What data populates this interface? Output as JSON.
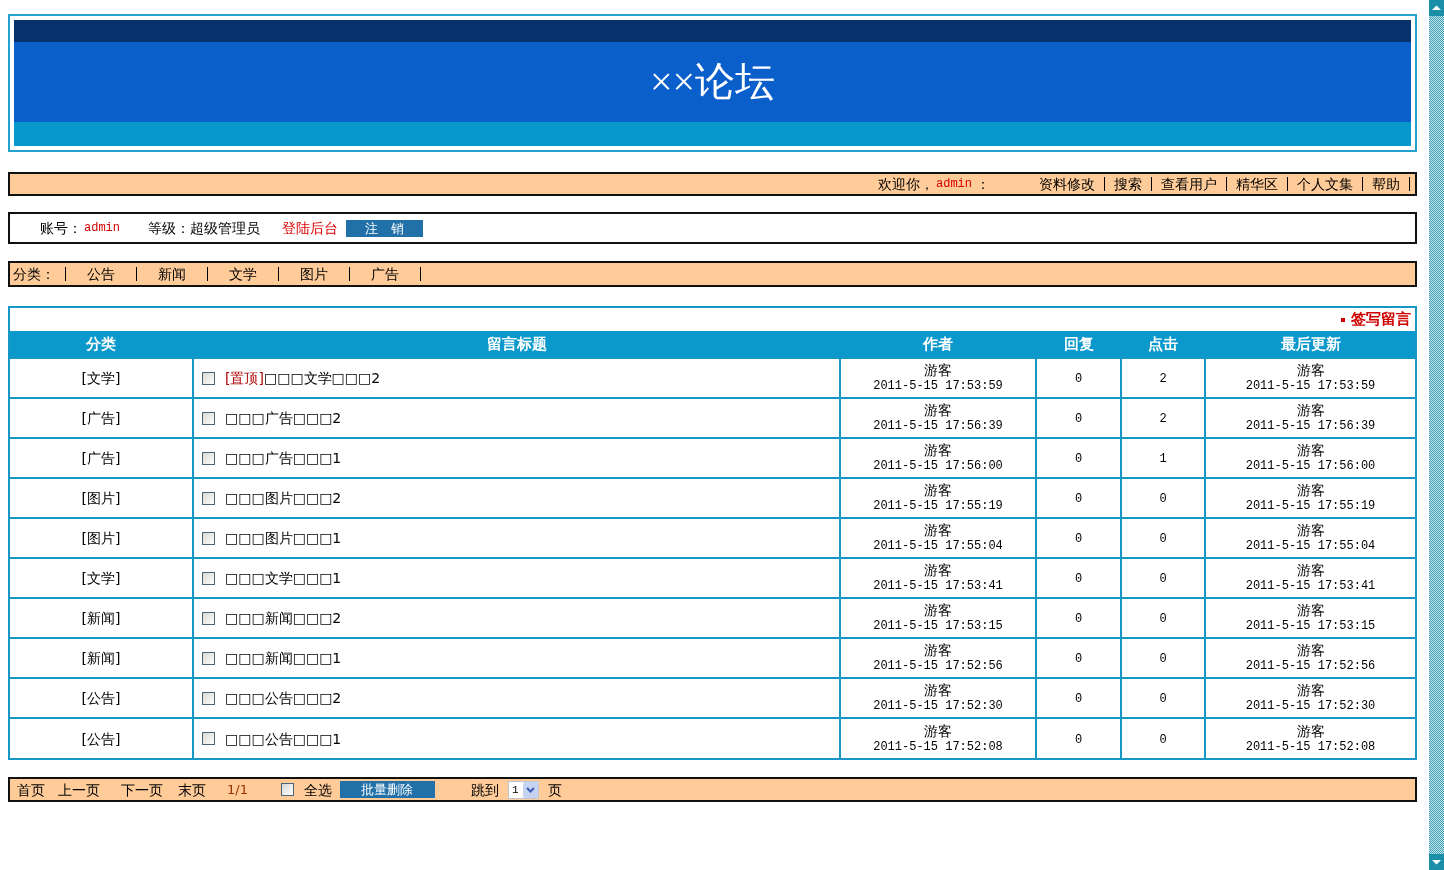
{
  "header": {
    "title": "××论坛"
  },
  "user_bar": {
    "greeting": "欢迎你，",
    "username": "admin",
    "username_suffix": "：",
    "links": [
      "资料修改",
      "搜索",
      "查看用户",
      "精华区",
      "个人文集",
      "帮助"
    ]
  },
  "account_bar": {
    "account_label": "账号：",
    "account": "admin",
    "level_label": "等级：",
    "level": "超级管理员",
    "admin_link": "登陆后台",
    "logout_button": "注　销"
  },
  "category_bar": {
    "label": "分类：",
    "categories": [
      "公告",
      "新闻",
      "文学",
      "图片",
      "广告"
    ]
  },
  "table": {
    "post_link": "签写留言",
    "columns": [
      "分类",
      "留言标题",
      "作者",
      "回复",
      "点击",
      "最后更新"
    ],
    "rows": [
      {
        "category": "[文学]",
        "checked": false,
        "pin_label": "[置顶]",
        "title": "□□□文学□□□2",
        "author": "游客",
        "posted": "2011-5-15 17:53:59",
        "replies": "0",
        "clicks": "2",
        "last_user": "游客",
        "last_time": "2011-5-15 17:53:59"
      },
      {
        "category": "[广告]",
        "checked": false,
        "title": "□□□广告□□□2",
        "author": "游客",
        "posted": "2011-5-15 17:56:39",
        "replies": "0",
        "clicks": "2",
        "last_user": "游客",
        "last_time": "2011-5-15 17:56:39"
      },
      {
        "category": "[广告]",
        "checked": false,
        "title": "□□□广告□□□1",
        "author": "游客",
        "posted": "2011-5-15 17:56:00",
        "replies": "0",
        "clicks": "1",
        "last_user": "游客",
        "last_time": "2011-5-15 17:56:00"
      },
      {
        "category": "[图片]",
        "checked": false,
        "title": "□□□图片□□□2",
        "author": "游客",
        "posted": "2011-5-15 17:55:19",
        "replies": "0",
        "clicks": "0",
        "last_user": "游客",
        "last_time": "2011-5-15 17:55:19"
      },
      {
        "category": "[图片]",
        "checked": false,
        "title": "□□□图片□□□1",
        "author": "游客",
        "posted": "2011-5-15 17:55:04",
        "replies": "0",
        "clicks": "0",
        "last_user": "游客",
        "last_time": "2011-5-15 17:55:04"
      },
      {
        "category": "[文学]",
        "checked": false,
        "title": "□□□文学□□□1",
        "author": "游客",
        "posted": "2011-5-15 17:53:41",
        "replies": "0",
        "clicks": "0",
        "last_user": "游客",
        "last_time": "2011-5-15 17:53:41"
      },
      {
        "category": "[新闻]",
        "checked": false,
        "title": "□□□新闻□□□2",
        "author": "游客",
        "posted": "2011-5-15 17:53:15",
        "replies": "0",
        "clicks": "0",
        "last_user": "游客",
        "last_time": "2011-5-15 17:53:15"
      },
      {
        "category": "[新闻]",
        "checked": false,
        "title": "□□□新闻□□□1",
        "author": "游客",
        "posted": "2011-5-15 17:52:56",
        "replies": "0",
        "clicks": "0",
        "last_user": "游客",
        "last_time": "2011-5-15 17:52:56"
      },
      {
        "category": "[公告]",
        "checked": false,
        "title": "□□□公告□□□2",
        "author": "游客",
        "posted": "2011-5-15 17:52:30",
        "replies": "0",
        "clicks": "0",
        "last_user": "游客",
        "last_time": "2011-5-15 17:52:30"
      },
      {
        "category": "[公告]",
        "checked": false,
        "title": "□□□公告□□□1",
        "author": "游客",
        "posted": "2011-5-15 17:52:08",
        "replies": "0",
        "clicks": "0",
        "last_user": "游客",
        "last_time": "2011-5-15 17:52:08"
      }
    ]
  },
  "footer": {
    "links": [
      "首页",
      "上一页",
      "下一页",
      "末页"
    ],
    "page": "1/1",
    "select_all": {
      "label": "全选",
      "checked": false
    },
    "delete_button": "批量删除",
    "jump_label": "跳到",
    "page_select": "1",
    "page_suffix": "页"
  }
}
